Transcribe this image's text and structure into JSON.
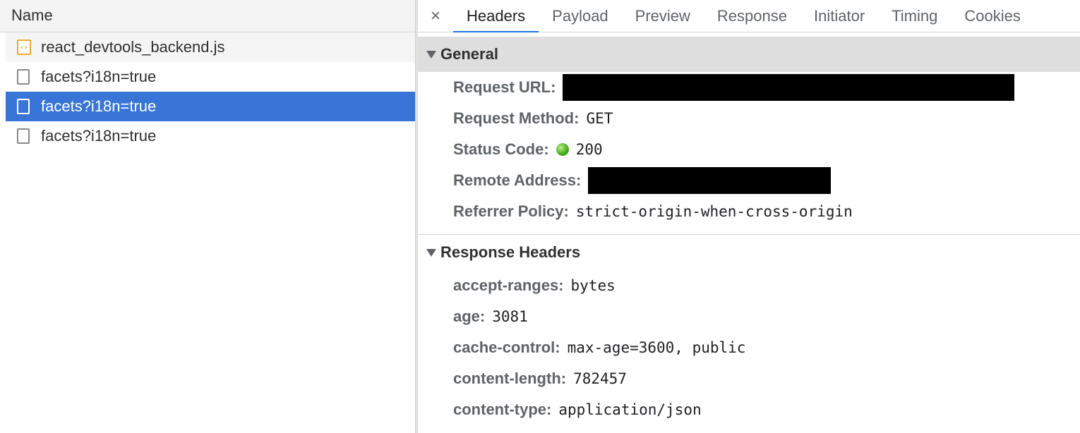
{
  "request_list": {
    "column_header": "Name",
    "rows": [
      {
        "name": "react_devtools_backend.js",
        "icon": "js-file-icon"
      },
      {
        "name": "facets?i18n=true",
        "icon": "document-icon"
      },
      {
        "name": "facets?i18n=true",
        "icon": "document-icon",
        "selected": true
      },
      {
        "name": "facets?i18n=true",
        "icon": "document-icon"
      }
    ]
  },
  "details": {
    "close_symbol": "×",
    "tabs": [
      "Headers",
      "Payload",
      "Preview",
      "Response",
      "Initiator",
      "Timing",
      "Cookies"
    ],
    "active_tab": "Headers",
    "general": {
      "title": "General",
      "request_url_label": "Request URL:",
      "request_method_label": "Request Method:",
      "request_method": "GET",
      "status_code_label": "Status Code:",
      "status_code": "200",
      "status_color": "#4caf1f",
      "remote_address_label": "Remote Address:",
      "referrer_policy_label": "Referrer Policy:",
      "referrer_policy": "strict-origin-when-cross-origin"
    },
    "response_headers": {
      "title": "Response Headers",
      "items": [
        {
          "key": "accept-ranges:",
          "value": "bytes"
        },
        {
          "key": "age:",
          "value": "3081"
        },
        {
          "key": "cache-control:",
          "value": "max-age=3600, public"
        },
        {
          "key": "content-length:",
          "value": "782457"
        },
        {
          "key": "content-type:",
          "value": "application/json"
        }
      ]
    }
  },
  "colors": {
    "selected_row": "#3875d7",
    "active_tab_underline": "#1a73e8",
    "js_icon": "#f0a830"
  }
}
